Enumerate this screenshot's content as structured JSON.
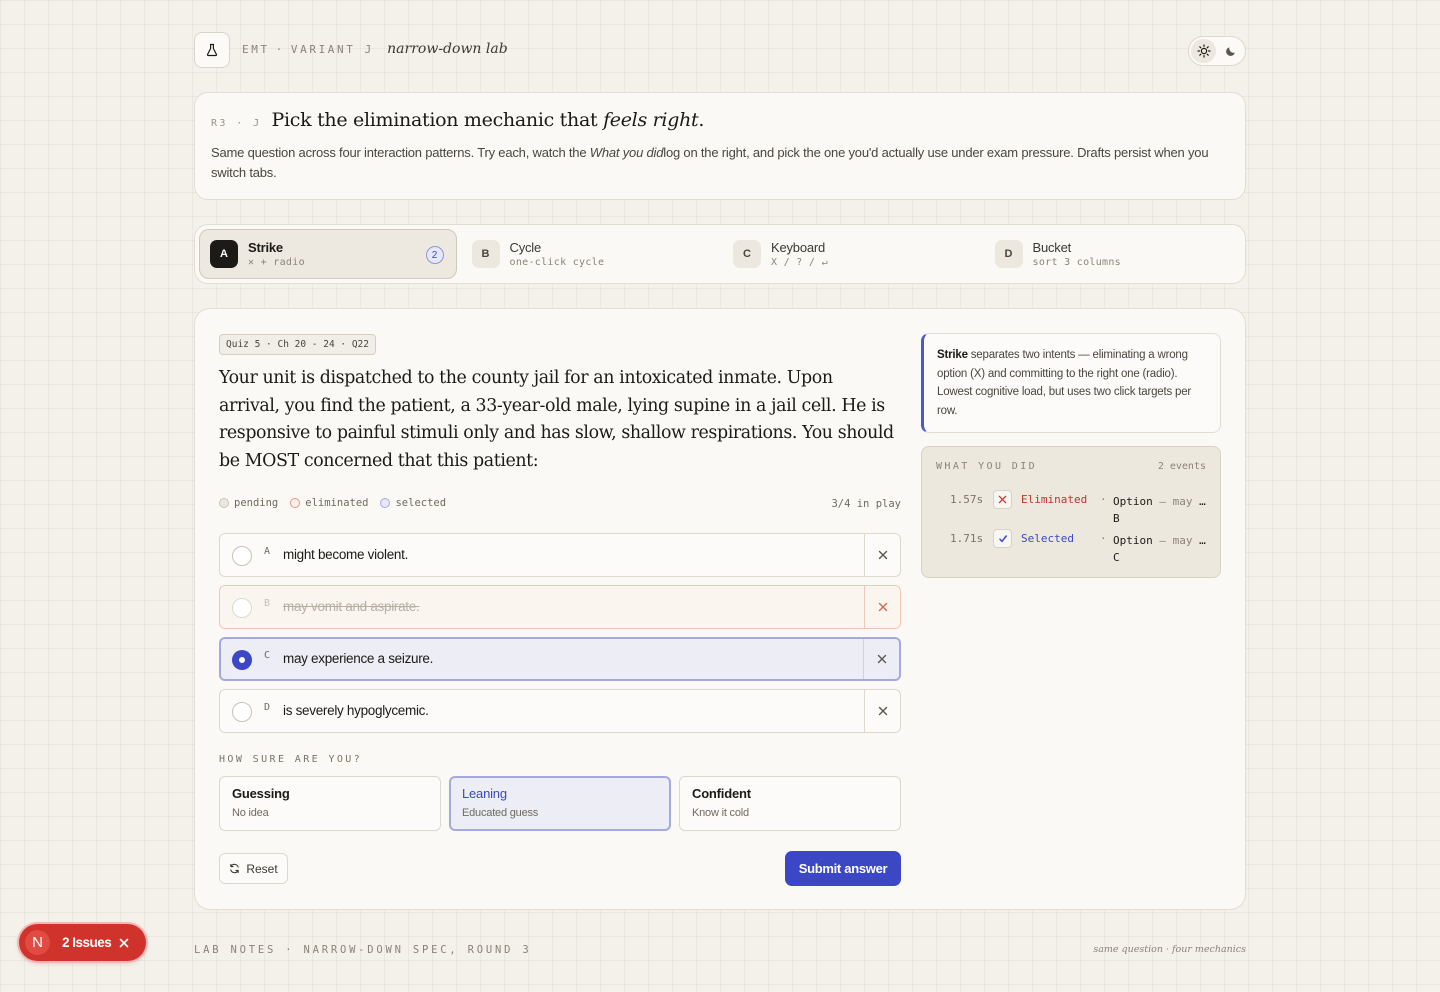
{
  "header": {
    "brand_primary": "EMT",
    "brand_sep": "·",
    "brand_variant": "VARIANT J",
    "brand_lab": "narrow-down lab"
  },
  "intro": {
    "tag": "R3 · J",
    "title_start": "Pick the elimination mechanic that ",
    "title_em": "feels right",
    "title_end": ".",
    "desc_start": "Same question across four interaction patterns. Try each, watch the ",
    "desc_em": "What you did",
    "desc_end": "log on the right, and pick the one you'd actually use under exam pressure. Drafts persist when you switch tabs."
  },
  "tabs": [
    {
      "key": "A",
      "label": "Strike",
      "sub": "✕ + radio",
      "badge": "2",
      "active": true
    },
    {
      "key": "B",
      "label": "Cycle",
      "sub": "one-click cycle"
    },
    {
      "key": "C",
      "label": "Keyboard",
      "sub": "X / ? / ↵"
    },
    {
      "key": "D",
      "label": "Bucket",
      "sub": "sort 3 columns"
    }
  ],
  "question": {
    "tag": "Quiz 5 · Ch 20 - 24 · Q22",
    "stem": "Your unit is dispatched to the county jail for an intoxicated inmate. Upon arrival, you find the patient, a 33-year-old male, lying supine in a jail cell. He is responsive to painful stimuli only and has slow, shallow respirations. You should be MOST concerned that this patient:",
    "legend": {
      "pending": "pending",
      "eliminated": "eliminated",
      "selected": "selected"
    },
    "in_play": "3/4 in play",
    "options": [
      {
        "letter": "A",
        "text": "might become violent.",
        "state": "pending"
      },
      {
        "letter": "B",
        "text": "may vomit and aspirate.",
        "state": "eliminated"
      },
      {
        "letter": "C",
        "text": "may experience a seizure.",
        "state": "selected"
      },
      {
        "letter": "D",
        "text": "is severely hypoglycemic.",
        "state": "pending"
      }
    ]
  },
  "confidence": {
    "label": "HOW SURE ARE YOU?",
    "options": [
      {
        "title": "Guessing",
        "sub": "No idea"
      },
      {
        "title": "Leaning",
        "sub": "Educated guess",
        "active": true
      },
      {
        "title": "Confident",
        "sub": "Know it cold"
      }
    ]
  },
  "actions": {
    "reset": "Reset",
    "submit": "Submit answer"
  },
  "note": {
    "bold": "Strike",
    "text": " separates two intents — eliminating a wrong option (X) and committing to the right one (radio). Lowest cognitive load, but uses two click targets per row."
  },
  "log": {
    "title": "WHAT YOU DID",
    "count": "2 events",
    "events": [
      {
        "time": "1.57s",
        "action": "Eliminated",
        "dot": "·",
        "option_line1": "Option",
        "option_detail": " — may vomit and aspirate.",
        "option_letter": "B"
      },
      {
        "time": "1.71s",
        "action": "Selected",
        "dot": "·",
        "option_line1": "Option",
        "option_detail": " — may experience a seizure.",
        "option_letter": "C"
      }
    ]
  },
  "footer": {
    "left": "LAB NOTES · NARROW-DOWN SPEC, ROUND 3",
    "right": "same question · four mechanics"
  },
  "issues": {
    "logo": "N",
    "label": "2 Issues"
  },
  "colors": {
    "accent": "#3b47c4",
    "eliminate": "#d0322c",
    "background": "#f4f1ea"
  }
}
